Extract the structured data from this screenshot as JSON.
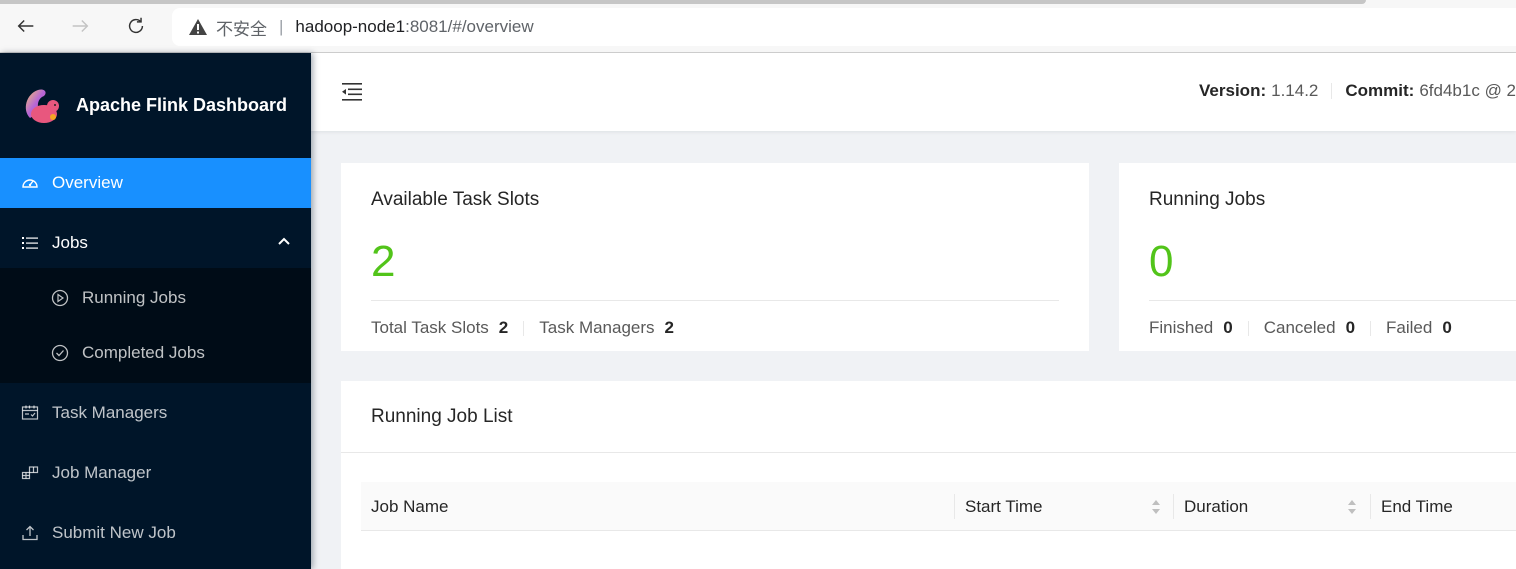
{
  "browser": {
    "insecure_label": "不安全",
    "separator": "|",
    "url_host": "hadoop-node1",
    "url_path": ":8081/#/overview",
    "back_icon": "arrow-left-icon",
    "forward_icon": "arrow-right-icon",
    "reload_icon": "reload-icon",
    "warning_icon": "warning-triangle-icon"
  },
  "sidebar": {
    "app_title": "Apache Flink Dashboard",
    "items": [
      {
        "label": "Overview",
        "icon": "dashboard-icon",
        "active": true
      },
      {
        "label": "Jobs",
        "icon": "list-icon",
        "expanded": true,
        "children": [
          {
            "label": "Running Jobs",
            "icon": "play-circle-icon"
          },
          {
            "label": "Completed Jobs",
            "icon": "check-circle-icon"
          }
        ]
      },
      {
        "label": "Task Managers",
        "icon": "schedule-icon"
      },
      {
        "label": "Job Manager",
        "icon": "build-icon"
      },
      {
        "label": "Submit New Job",
        "icon": "upload-icon"
      }
    ]
  },
  "header": {
    "version_label": "Version:",
    "version_value": "1.14.2",
    "commit_label": "Commit:",
    "commit_value": "6fd4b1c @ 2"
  },
  "cards": {
    "slots": {
      "title": "Available Task Slots",
      "value": "2",
      "footer": [
        {
          "label": "Total Task Slots",
          "value": "2"
        },
        {
          "label": "Task Managers",
          "value": "2"
        }
      ]
    },
    "running": {
      "title": "Running Jobs",
      "value": "0",
      "footer": [
        {
          "label": "Finished",
          "value": "0"
        },
        {
          "label": "Canceled",
          "value": "0"
        },
        {
          "label": "Failed",
          "value": "0"
        }
      ]
    }
  },
  "job_list": {
    "title": "Running Job List",
    "columns": [
      "Job Name",
      "Start Time",
      "Duration",
      "End Time"
    ],
    "rows": []
  },
  "colors": {
    "sidebar_bg": "#001529",
    "active": "#1890ff",
    "success": "#52c41a"
  }
}
